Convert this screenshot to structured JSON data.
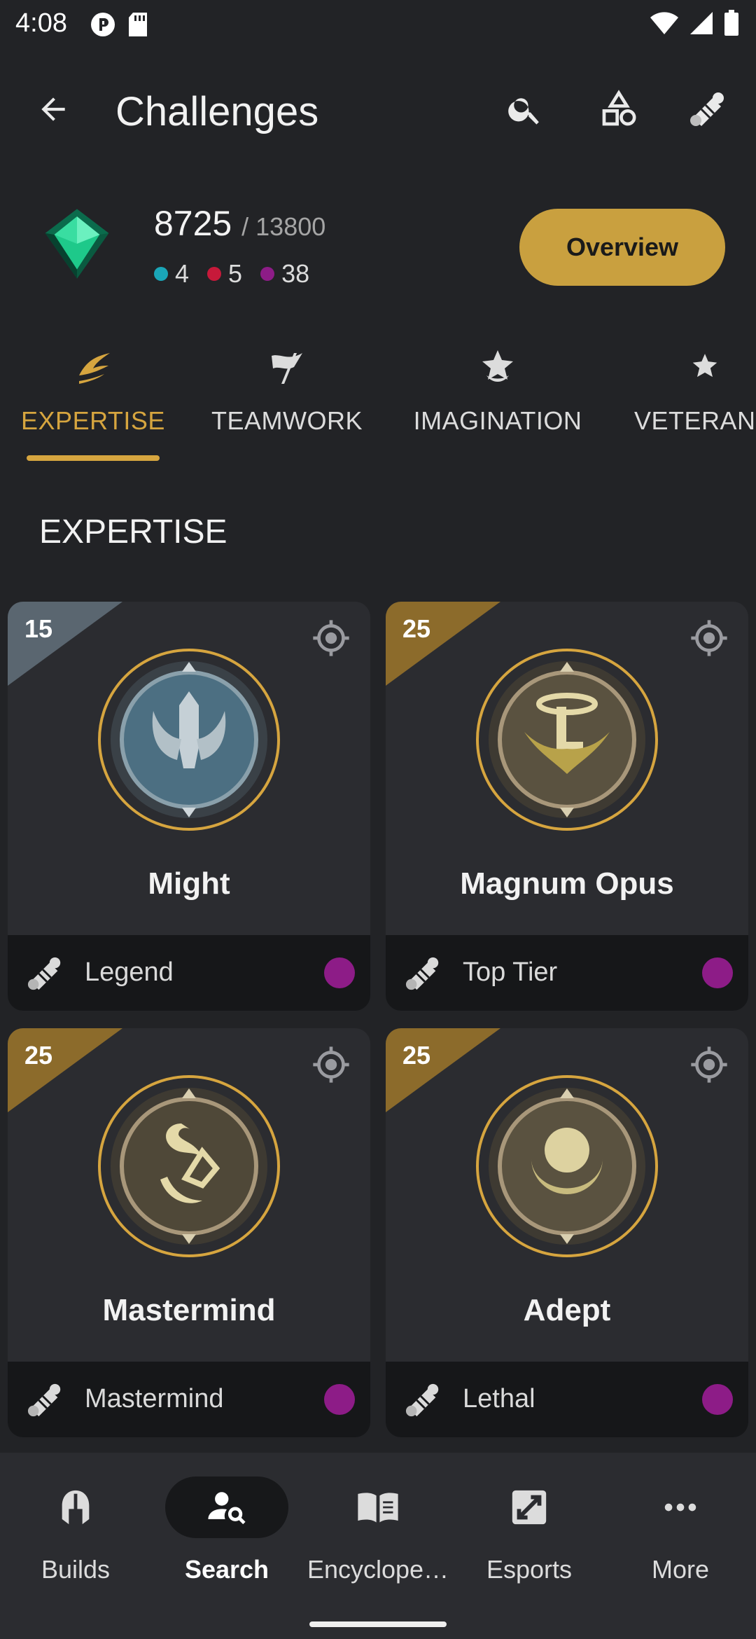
{
  "status_bar": {
    "time": "4:08",
    "icons": [
      "notification-p-icon",
      "sd-card-icon",
      "wifi-icon",
      "signal-icon",
      "battery-icon"
    ]
  },
  "app_bar": {
    "title": "Challenges",
    "actions": [
      "search-icon",
      "shapes-icon",
      "scroll-icon"
    ]
  },
  "summary": {
    "points": "8725",
    "total": "/ 13800",
    "counts": [
      {
        "value": "4",
        "color": "#1aa6b8"
      },
      {
        "value": "5",
        "color": "#c7193a"
      },
      {
        "value": "38",
        "color": "#8d1c87"
      }
    ],
    "overview_label": "Overview"
  },
  "tabs": [
    {
      "label": "EXPERTISE",
      "icon": "expertise-icon",
      "active": true
    },
    {
      "label": "TEAMWORK",
      "icon": "teamwork-flag-icon",
      "active": false
    },
    {
      "label": "IMAGINATION",
      "icon": "imagination-icon",
      "active": false
    },
    {
      "label": "VETERANCY",
      "icon": "veterancy-icon",
      "active": false
    }
  ],
  "section_title": "EXPERTISE",
  "cards": [
    {
      "tier": "15",
      "tier_color": "#5a6670",
      "name": "Might",
      "reward": "Legend",
      "dot_color": "#8d1c87"
    },
    {
      "tier": "25",
      "tier_color": "#8c6b2b",
      "name": "Magnum Opus",
      "reward": "Top Tier",
      "dot_color": "#8d1c87"
    },
    {
      "tier": "25",
      "tier_color": "#8c6b2b",
      "name": "Mastermind",
      "reward": "Mastermind",
      "dot_color": "#8d1c87"
    },
    {
      "tier": "25",
      "tier_color": "#8c6b2b",
      "name": "Adept",
      "reward": "Lethal",
      "dot_color": "#8d1c87"
    }
  ],
  "bottom_nav": [
    {
      "label": "Builds",
      "icon": "helmet-icon",
      "active": false
    },
    {
      "label": "Search",
      "icon": "person-search-icon",
      "active": true
    },
    {
      "label": "Encyclope…",
      "icon": "book-icon",
      "active": false
    },
    {
      "label": "Esports",
      "icon": "esports-icon",
      "active": false
    },
    {
      "label": "More",
      "icon": "more-dots-icon",
      "active": false
    }
  ],
  "colors": {
    "accent": "#d6a53f",
    "button": "#c9a03f",
    "background": "#222326",
    "card": "#2b2c30"
  }
}
